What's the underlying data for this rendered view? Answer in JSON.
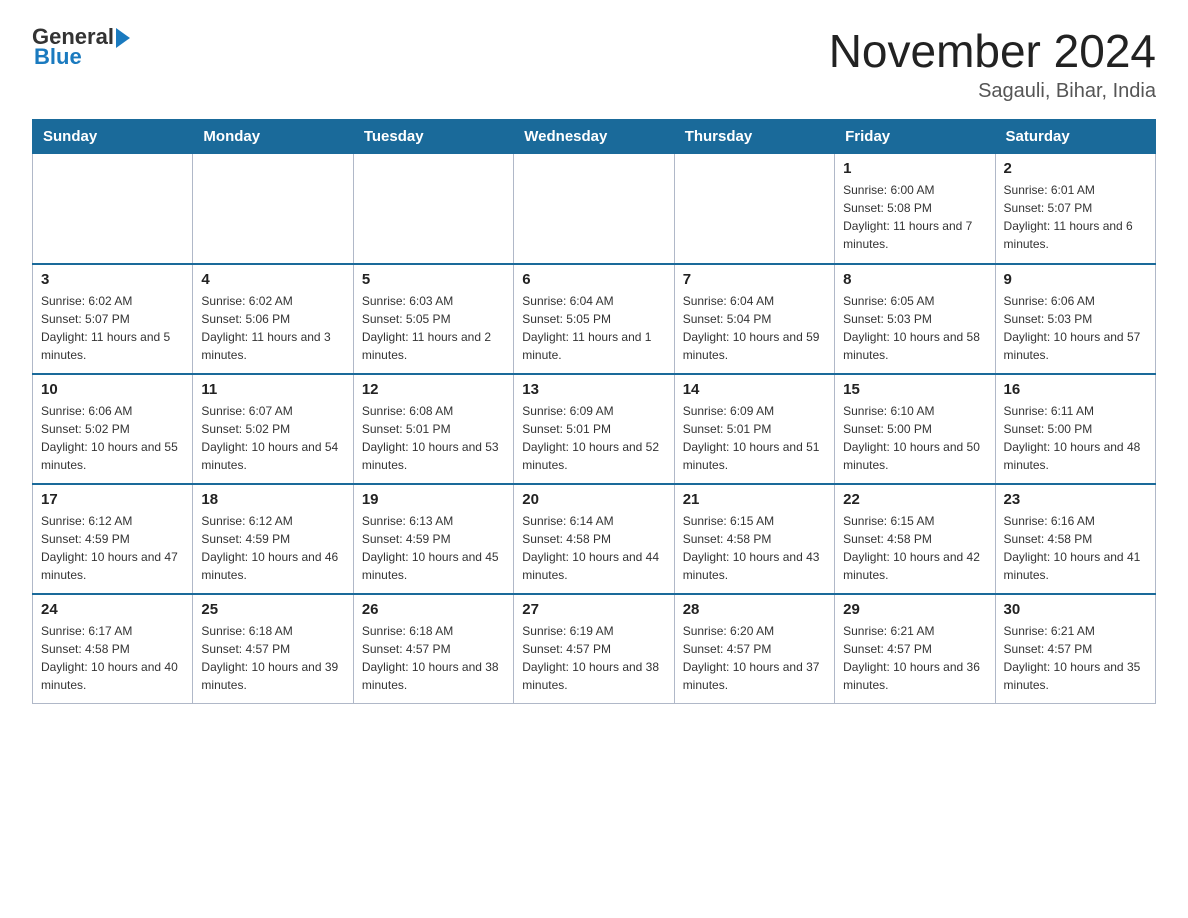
{
  "header": {
    "logo_text_general": "General",
    "logo_text_blue": "Blue",
    "month_title": "November 2024",
    "location": "Sagauli, Bihar, India"
  },
  "days_of_week": [
    "Sunday",
    "Monday",
    "Tuesday",
    "Wednesday",
    "Thursday",
    "Friday",
    "Saturday"
  ],
  "weeks": [
    {
      "cells": [
        {
          "day": "",
          "info": ""
        },
        {
          "day": "",
          "info": ""
        },
        {
          "day": "",
          "info": ""
        },
        {
          "day": "",
          "info": ""
        },
        {
          "day": "",
          "info": ""
        },
        {
          "day": "1",
          "info": "Sunrise: 6:00 AM\nSunset: 5:08 PM\nDaylight: 11 hours and 7 minutes."
        },
        {
          "day": "2",
          "info": "Sunrise: 6:01 AM\nSunset: 5:07 PM\nDaylight: 11 hours and 6 minutes."
        }
      ]
    },
    {
      "cells": [
        {
          "day": "3",
          "info": "Sunrise: 6:02 AM\nSunset: 5:07 PM\nDaylight: 11 hours and 5 minutes."
        },
        {
          "day": "4",
          "info": "Sunrise: 6:02 AM\nSunset: 5:06 PM\nDaylight: 11 hours and 3 minutes."
        },
        {
          "day": "5",
          "info": "Sunrise: 6:03 AM\nSunset: 5:05 PM\nDaylight: 11 hours and 2 minutes."
        },
        {
          "day": "6",
          "info": "Sunrise: 6:04 AM\nSunset: 5:05 PM\nDaylight: 11 hours and 1 minute."
        },
        {
          "day": "7",
          "info": "Sunrise: 6:04 AM\nSunset: 5:04 PM\nDaylight: 10 hours and 59 minutes."
        },
        {
          "day": "8",
          "info": "Sunrise: 6:05 AM\nSunset: 5:03 PM\nDaylight: 10 hours and 58 minutes."
        },
        {
          "day": "9",
          "info": "Sunrise: 6:06 AM\nSunset: 5:03 PM\nDaylight: 10 hours and 57 minutes."
        }
      ]
    },
    {
      "cells": [
        {
          "day": "10",
          "info": "Sunrise: 6:06 AM\nSunset: 5:02 PM\nDaylight: 10 hours and 55 minutes."
        },
        {
          "day": "11",
          "info": "Sunrise: 6:07 AM\nSunset: 5:02 PM\nDaylight: 10 hours and 54 minutes."
        },
        {
          "day": "12",
          "info": "Sunrise: 6:08 AM\nSunset: 5:01 PM\nDaylight: 10 hours and 53 minutes."
        },
        {
          "day": "13",
          "info": "Sunrise: 6:09 AM\nSunset: 5:01 PM\nDaylight: 10 hours and 52 minutes."
        },
        {
          "day": "14",
          "info": "Sunrise: 6:09 AM\nSunset: 5:01 PM\nDaylight: 10 hours and 51 minutes."
        },
        {
          "day": "15",
          "info": "Sunrise: 6:10 AM\nSunset: 5:00 PM\nDaylight: 10 hours and 50 minutes."
        },
        {
          "day": "16",
          "info": "Sunrise: 6:11 AM\nSunset: 5:00 PM\nDaylight: 10 hours and 48 minutes."
        }
      ]
    },
    {
      "cells": [
        {
          "day": "17",
          "info": "Sunrise: 6:12 AM\nSunset: 4:59 PM\nDaylight: 10 hours and 47 minutes."
        },
        {
          "day": "18",
          "info": "Sunrise: 6:12 AM\nSunset: 4:59 PM\nDaylight: 10 hours and 46 minutes."
        },
        {
          "day": "19",
          "info": "Sunrise: 6:13 AM\nSunset: 4:59 PM\nDaylight: 10 hours and 45 minutes."
        },
        {
          "day": "20",
          "info": "Sunrise: 6:14 AM\nSunset: 4:58 PM\nDaylight: 10 hours and 44 minutes."
        },
        {
          "day": "21",
          "info": "Sunrise: 6:15 AM\nSunset: 4:58 PM\nDaylight: 10 hours and 43 minutes."
        },
        {
          "day": "22",
          "info": "Sunrise: 6:15 AM\nSunset: 4:58 PM\nDaylight: 10 hours and 42 minutes."
        },
        {
          "day": "23",
          "info": "Sunrise: 6:16 AM\nSunset: 4:58 PM\nDaylight: 10 hours and 41 minutes."
        }
      ]
    },
    {
      "cells": [
        {
          "day": "24",
          "info": "Sunrise: 6:17 AM\nSunset: 4:58 PM\nDaylight: 10 hours and 40 minutes."
        },
        {
          "day": "25",
          "info": "Sunrise: 6:18 AM\nSunset: 4:57 PM\nDaylight: 10 hours and 39 minutes."
        },
        {
          "day": "26",
          "info": "Sunrise: 6:18 AM\nSunset: 4:57 PM\nDaylight: 10 hours and 38 minutes."
        },
        {
          "day": "27",
          "info": "Sunrise: 6:19 AM\nSunset: 4:57 PM\nDaylight: 10 hours and 38 minutes."
        },
        {
          "day": "28",
          "info": "Sunrise: 6:20 AM\nSunset: 4:57 PM\nDaylight: 10 hours and 37 minutes."
        },
        {
          "day": "29",
          "info": "Sunrise: 6:21 AM\nSunset: 4:57 PM\nDaylight: 10 hours and 36 minutes."
        },
        {
          "day": "30",
          "info": "Sunrise: 6:21 AM\nSunset: 4:57 PM\nDaylight: 10 hours and 35 minutes."
        }
      ]
    }
  ]
}
